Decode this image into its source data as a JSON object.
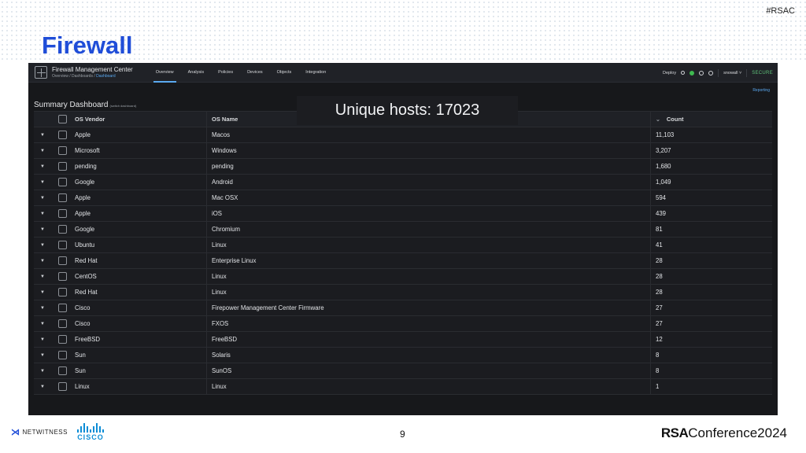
{
  "slide": {
    "hashtag": "#RSAC",
    "title": "Firewall",
    "page_number": "9",
    "footer_brands": {
      "netwitness": "NETWITNESS",
      "cisco": "CISCO",
      "rsac_bold": "RSA",
      "rsac_rest": "Conference2024"
    }
  },
  "app": {
    "name": "Firewall Management Center",
    "breadcrumb_prefix": "Overview / Dashboards / ",
    "breadcrumb_link": "Dashboard",
    "nav": [
      {
        "label": "Overview",
        "active": true
      },
      {
        "label": "Analysis",
        "active": false
      },
      {
        "label": "Policies",
        "active": false
      },
      {
        "label": "Devices",
        "active": false
      },
      {
        "label": "Objects",
        "active": false
      },
      {
        "label": "Integration",
        "active": false
      }
    ],
    "deploy_label": "Deploy",
    "user_label": "snowall",
    "secure_label": "SECURE",
    "reporting_link": "Reporting",
    "dashboard_title": "Summary Dashboard",
    "dashboard_subtitle": "(switch dashboard)",
    "overlay_text": "Unique hosts: 17023",
    "columns": {
      "vendor": "OS Vendor",
      "os": "OS Name",
      "count": "Count"
    },
    "rows": [
      {
        "vendor": "Apple",
        "os": "Macos",
        "count": "11,103"
      },
      {
        "vendor": "Microsoft",
        "os": "Windows",
        "count": "3,207"
      },
      {
        "vendor": "pending",
        "os": "pending",
        "count": "1,680"
      },
      {
        "vendor": "Google",
        "os": "Android",
        "count": "1,049"
      },
      {
        "vendor": "Apple",
        "os": "Mac OSX",
        "count": "594"
      },
      {
        "vendor": "Apple",
        "os": "iOS",
        "count": "439"
      },
      {
        "vendor": "Google",
        "os": "Chromium",
        "count": "81"
      },
      {
        "vendor": "Ubuntu",
        "os": "Linux",
        "count": "41"
      },
      {
        "vendor": "Red Hat",
        "os": "Enterprise Linux",
        "count": "28"
      },
      {
        "vendor": "CentOS",
        "os": "Linux",
        "count": "28"
      },
      {
        "vendor": "Red Hat",
        "os": "Linux",
        "count": "28"
      },
      {
        "vendor": "Cisco",
        "os": "Firepower Management Center Firmware",
        "count": "27"
      },
      {
        "vendor": "Cisco",
        "os": "FXOS",
        "count": "27"
      },
      {
        "vendor": "FreeBSD",
        "os": "FreeBSD",
        "count": "12"
      },
      {
        "vendor": "Sun",
        "os": "Solaris",
        "count": "8"
      },
      {
        "vendor": "Sun",
        "os": "SunOS",
        "count": "8"
      },
      {
        "vendor": "Linux",
        "os": "Linux",
        "count": "1"
      }
    ]
  }
}
